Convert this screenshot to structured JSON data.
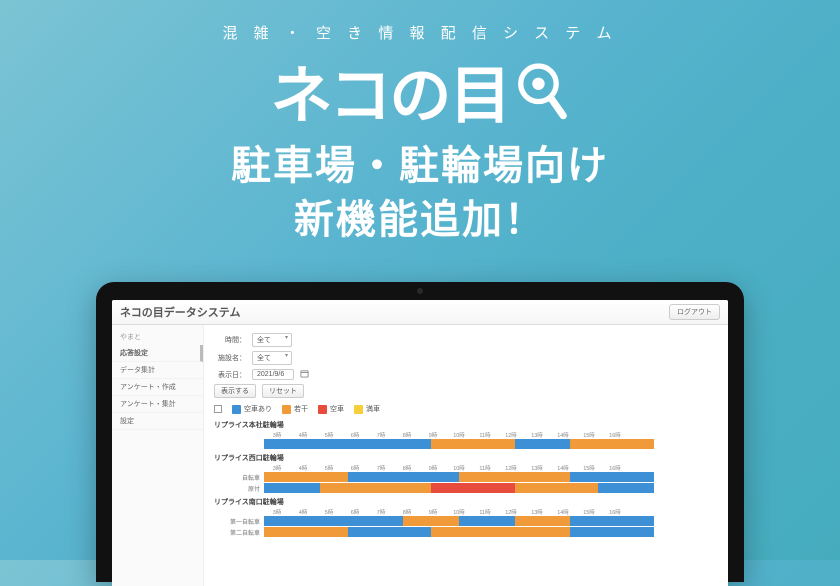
{
  "hero": {
    "tagline": "混 雑 ・ 空 き 情 報 配 信 シ ス テ ム",
    "logo_text": "ネコの目",
    "headline_1": "駐車場・駐輪場向け",
    "headline_2": "新機能追加！"
  },
  "app": {
    "title": "ネコの目データシステム",
    "logout": "ログアウト",
    "sidebar": {
      "group": "やまと",
      "items": [
        "応答設定",
        "データ集計",
        "アンケート・作成",
        "アンケート・集計",
        "設定"
      ]
    },
    "form": {
      "field1_label": "時間：",
      "field1_value": "全て",
      "field2_label": "施設名：",
      "field2_value": "全て",
      "field3_label": "表示日：",
      "field3_value": "2021/9/6",
      "btn_show": "表示する",
      "btn_reset": "リセット"
    },
    "legend": [
      {
        "name": "空車あり",
        "color": "#3D8FD6"
      },
      {
        "name": "若干",
        "color": "#F09A3A"
      },
      {
        "name": "空車",
        "color": "#E84C3D"
      },
      {
        "name": "満車",
        "color": "#F7CF3C"
      }
    ],
    "axis": [
      "3時",
      "4時",
      "5時",
      "6時",
      "7時",
      "8時",
      "9時",
      "10時",
      "11時",
      "12時",
      "13時",
      "14時",
      "15時",
      "16時"
    ],
    "colors": {
      "blue": "#3D8FD6",
      "orange": "#F09A3A",
      "red": "#E84C3D",
      "yellow": "#F7CF3C"
    },
    "groups": [
      {
        "title": "リプライス本社駐輪場",
        "rows": [
          {
            "label": "",
            "segs": [
              [
                "blue",
                6
              ],
              [
                "orange",
                3
              ],
              [
                "blue",
                2
              ],
              [
                "orange",
                3
              ]
            ]
          }
        ]
      },
      {
        "title": "リプライス西口駐輪場",
        "rows": [
          {
            "label": "自転車",
            "segs": [
              [
                "orange",
                3
              ],
              [
                "blue",
                4
              ],
              [
                "orange",
                4
              ],
              [
                "blue",
                3
              ]
            ]
          },
          {
            "label": "原付",
            "segs": [
              [
                "blue",
                2
              ],
              [
                "orange",
                4
              ],
              [
                "red",
                3
              ],
              [
                "orange",
                3
              ],
              [
                "blue",
                2
              ]
            ]
          }
        ]
      },
      {
        "title": "リプライス南口駐輪場",
        "rows": [
          {
            "label": "第一自転車",
            "segs": [
              [
                "blue",
                5
              ],
              [
                "orange",
                2
              ],
              [
                "blue",
                2
              ],
              [
                "orange",
                2
              ],
              [
                "blue",
                3
              ]
            ]
          },
          {
            "label": "第二自転車",
            "segs": [
              [
                "orange",
                3
              ],
              [
                "blue",
                3
              ],
              [
                "orange",
                5
              ],
              [
                "blue",
                3
              ]
            ]
          }
        ]
      }
    ]
  }
}
